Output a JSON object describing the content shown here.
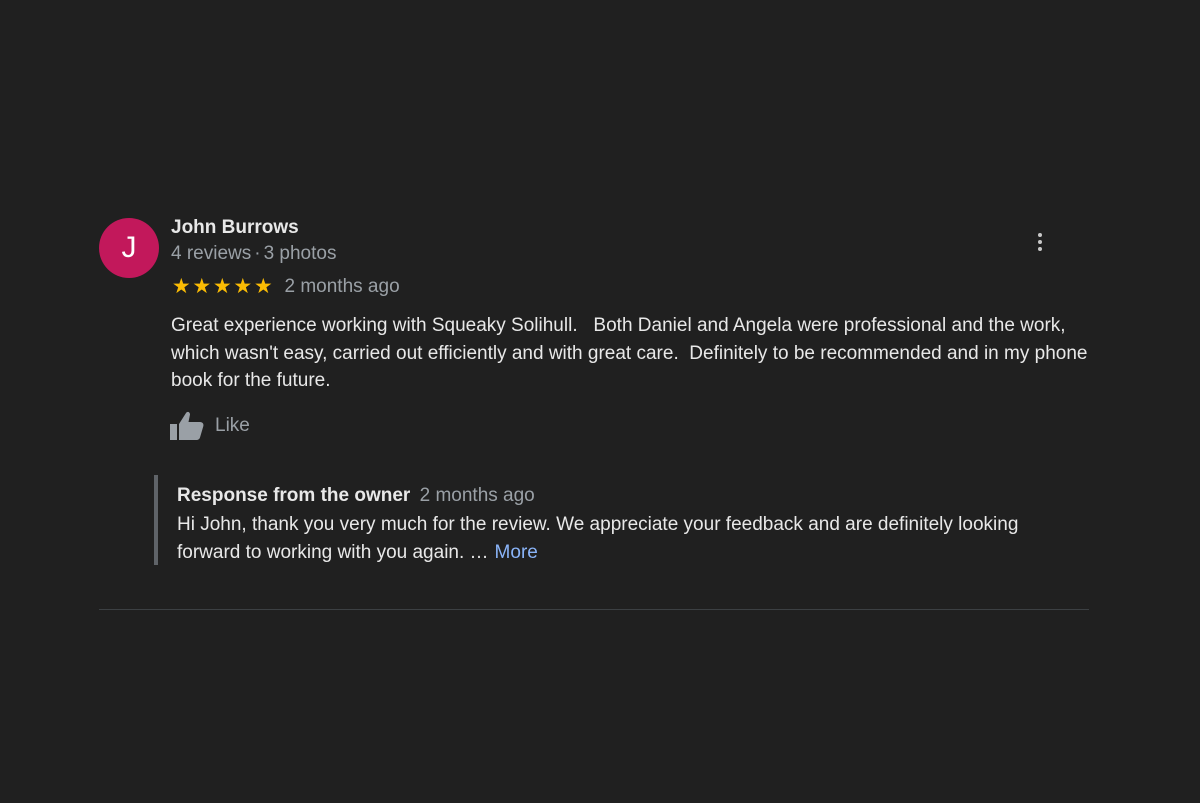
{
  "review": {
    "avatar_letter": "J",
    "avatar_color": "#c2185b",
    "author": "John Burrows",
    "reviews_count": "4 reviews",
    "meta_separator": "·",
    "photos_count": "3 photos",
    "rating": 5,
    "rating_max": 5,
    "star_color": "#fbbc04",
    "time_ago": "2 months ago",
    "text": "Great experience working with Squeaky Solihull.   Both Daniel and Angela were professional and the work, which wasn't easy, carried out efficiently and with great care.  Definitely to be recommended and in my phone book for the future.",
    "like_label": "Like",
    "like_icon": "thumbs-up-icon",
    "menu_icon": "more-vertical-icon"
  },
  "owner_response": {
    "title": "Response from the owner",
    "time_ago": "2 months ago",
    "text": "Hi John, thank you very much for the review. We appreciate your feedback and are definitely looking forward to working with you again. …",
    "more_label": "More",
    "link_color": "#8ab4f8"
  }
}
